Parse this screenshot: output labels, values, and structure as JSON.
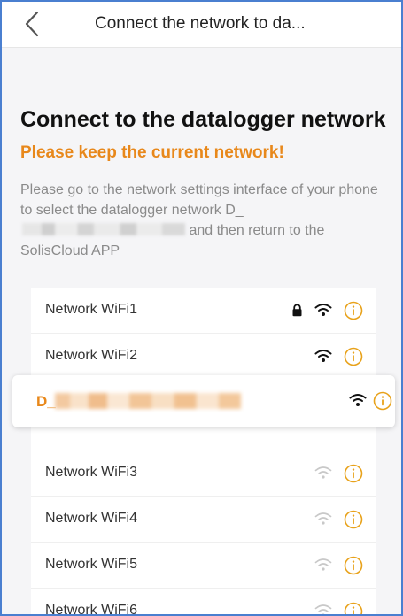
{
  "header": {
    "back_label": "Back",
    "title": "Connect the network to da..."
  },
  "main": {
    "title": "Connect to the datalogger network",
    "warning": "Please keep the current network!",
    "instructions_part1": "Please go to the network settings interface of your phone to select the datalogger network D_",
    "instructions_part2": " and then return to the SolisCloud APP"
  },
  "networks_top": [
    {
      "name": "Network WiFi1",
      "locked": true,
      "signal": "strong"
    },
    {
      "name": "Network WiFi2",
      "locked": false,
      "signal": "strong"
    }
  ],
  "selected_network": {
    "name_prefix": "D_",
    "signal": "strong"
  },
  "networks_bottom": [
    {
      "name": "Network WiFi3",
      "signal": "weak"
    },
    {
      "name": "Network WiFi4",
      "signal": "weak"
    },
    {
      "name": "Network WiFi5",
      "signal": "weak"
    },
    {
      "name": "Network WiFi6",
      "signal": "weak"
    }
  ],
  "colors": {
    "accent": "#e8881b",
    "signal_strong": "#111111",
    "signal_weak": "#c8c8c8",
    "info": "#e8a21b"
  },
  "icons": {
    "back": "chevron-left-icon",
    "lock": "lock-icon",
    "wifi": "wifi-signal-icon",
    "info": "info-circle-icon"
  }
}
